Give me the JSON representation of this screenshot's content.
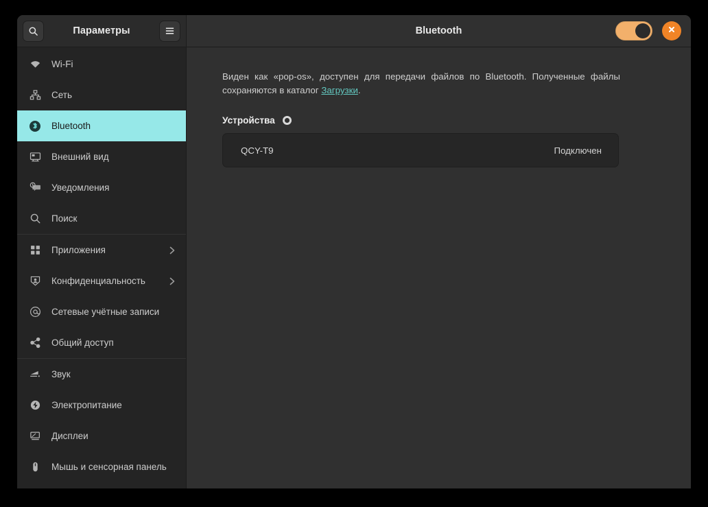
{
  "window": {
    "app_title": "Параметры",
    "page_title": "Bluetooth"
  },
  "header": {
    "search_icon": "search-icon",
    "menu_icon": "hamburger-menu-icon",
    "bluetooth_toggle_state": "on",
    "close_icon": "close-icon",
    "accent_color": "#f2b06b",
    "close_color": "#f08427"
  },
  "sidebar": {
    "selected": "Bluetooth",
    "highlight_color": "#96e8e8",
    "items": [
      {
        "label": "Wi-Fi",
        "icon": "wifi-icon",
        "chevron": false,
        "selected": false
      },
      {
        "label": "Сеть",
        "icon": "network-icon",
        "chevron": false,
        "selected": false
      },
      {
        "label": "Bluetooth",
        "icon": "bluetooth-icon",
        "chevron": false,
        "selected": true
      },
      {
        "label": "Внешний вид",
        "icon": "appearance-icon",
        "chevron": false,
        "selected": false
      },
      {
        "label": "Уведомления",
        "icon": "notifications-icon",
        "chevron": false,
        "selected": false
      },
      {
        "label": "Поиск",
        "icon": "search-icon",
        "chevron": false,
        "selected": false
      },
      {
        "label": "Приложения",
        "icon": "applications-icon",
        "chevron": true,
        "selected": false
      },
      {
        "label": "Конфиденциальность",
        "icon": "privacy-shield-icon",
        "chevron": true,
        "selected": false
      },
      {
        "label": "Сетевые учётные записи",
        "icon": "online-accounts-at-icon",
        "chevron": false,
        "selected": false
      },
      {
        "label": "Общий доступ",
        "icon": "sharing-icon",
        "chevron": false,
        "selected": false
      },
      {
        "label": "Звук",
        "icon": "sound-icon",
        "chevron": false,
        "selected": false
      },
      {
        "label": "Электропитание",
        "icon": "power-icon",
        "chevron": false,
        "selected": false
      },
      {
        "label": "Дисплеи",
        "icon": "displays-icon",
        "chevron": false,
        "selected": false
      },
      {
        "label": "Мышь и сенсорная панель",
        "icon": "mouse-icon",
        "chevron": false,
        "selected": false
      }
    ]
  },
  "main": {
    "description_part1": "Виден как «pop-os», доступен для передачи файлов по Bluetooth. Полученные файлы сохраняются в каталог ",
    "description_link": "Загрузки",
    "description_part2": ".",
    "devices_heading": "Устройства",
    "spinner_icon": "loading-spinner-icon",
    "devices": [
      {
        "name": "QCY-T9",
        "status": "Подключен"
      }
    ]
  }
}
